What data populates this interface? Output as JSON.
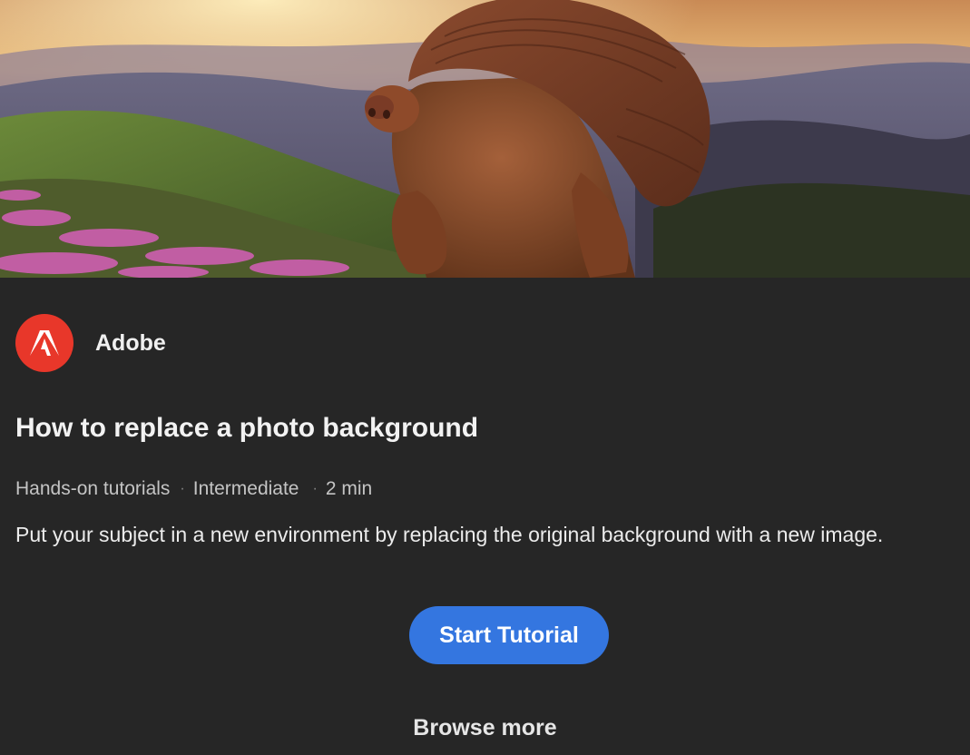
{
  "hero": {
    "image": "dog-in-knit-beanie-over-mountain-sunset"
  },
  "publisher": {
    "name": "Adobe",
    "logo": "adobe-logo-icon",
    "logo_color": "#e8372a"
  },
  "tutorial": {
    "title": "How to replace a photo background",
    "category": "Hands-on tutorials",
    "separator": "·",
    "level": "Intermediate",
    "duration": "2 min",
    "description": "Put your subject in a new environment by replacing the original background with a new image."
  },
  "actions": {
    "start_label": "Start Tutorial",
    "start_color": "#3476e0",
    "browse_label": "Browse more"
  }
}
